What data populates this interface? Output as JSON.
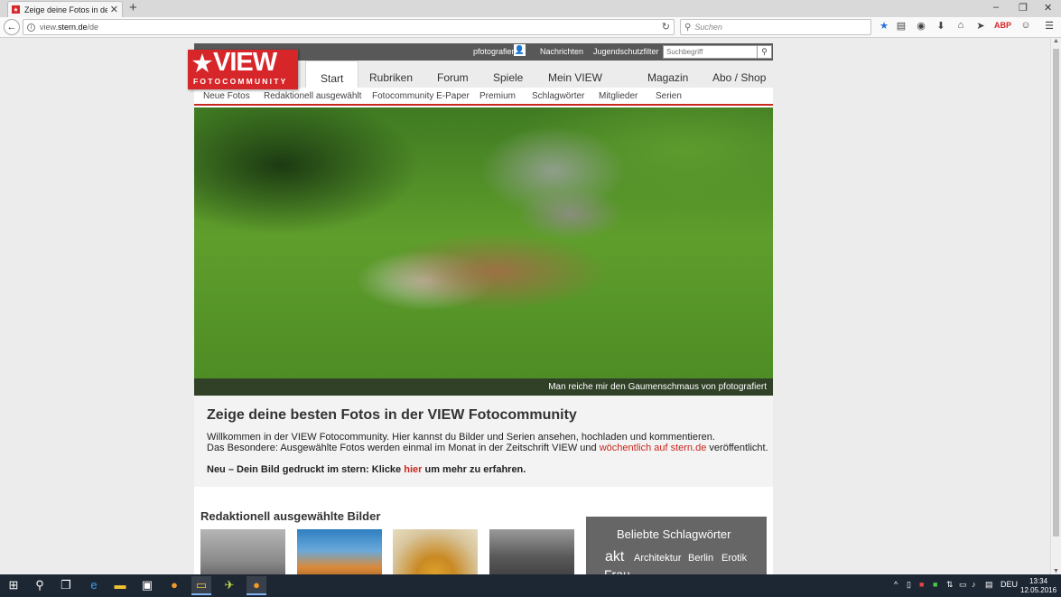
{
  "browser": {
    "tab_title": "Zeige deine Fotos in der Vi...",
    "new_tab": "+",
    "url_prefix": "view.",
    "url_domain": "stern.de",
    "url_path": "/de",
    "search_placeholder": "Suchen",
    "window_min": "–",
    "window_restore": "❐",
    "window_close": "✕"
  },
  "site": {
    "topbar": {
      "links": [
        "pfotografiert",
        "Nachrichten",
        "Jugendschutzfilter"
      ],
      "search_placeholder": "Suchbegriff"
    },
    "logo": {
      "word": "VIEW",
      "sub": "FOTOCOMMUNITY"
    },
    "mainnav": [
      "Start",
      "Rubriken",
      "Forum",
      "Spiele",
      "Mein VIEW",
      "Magazin",
      "Abo / Shop"
    ],
    "subnav": [
      "Neue Fotos",
      "Redaktionell ausgewählt",
      "Fotocommunity E-Paper",
      "Premium",
      "Schlagwörter",
      "Mitglieder",
      "Serien"
    ],
    "hero_caption": "Man reiche mir den Gaumenschmaus von pfotografiert",
    "intro": {
      "title": "Zeige deine besten Fotos in der VIEW Fotocommunity",
      "line1": "Willkommen in der VIEW Fotocommunity. Hier kannst du Bilder und Serien ansehen, hochladen und kommentieren.",
      "line2_pre": "Das Besondere: Ausgewählte Fotos werden einmal im Monat in der Zeitschrift VIEW und ",
      "line2_link": "wöchentlich auf stern.de",
      "line2_post": " veröffentlicht.",
      "bold_pre": "Neu – Dein Bild gedruckt im stern: Klicke ",
      "bold_link": "hier",
      "bold_post": " um mehr zu erfahren."
    },
    "section_title": "Redaktionell ausgewählte Bilder",
    "tags": {
      "title": "Beliebte Schlagwörter",
      "items": [
        "akt",
        "Architektur",
        "Berlin",
        "Erotik",
        "Frau"
      ]
    }
  },
  "taskbar": {
    "lang": "DEU",
    "time": "13:34",
    "date": "12.05.2016"
  }
}
